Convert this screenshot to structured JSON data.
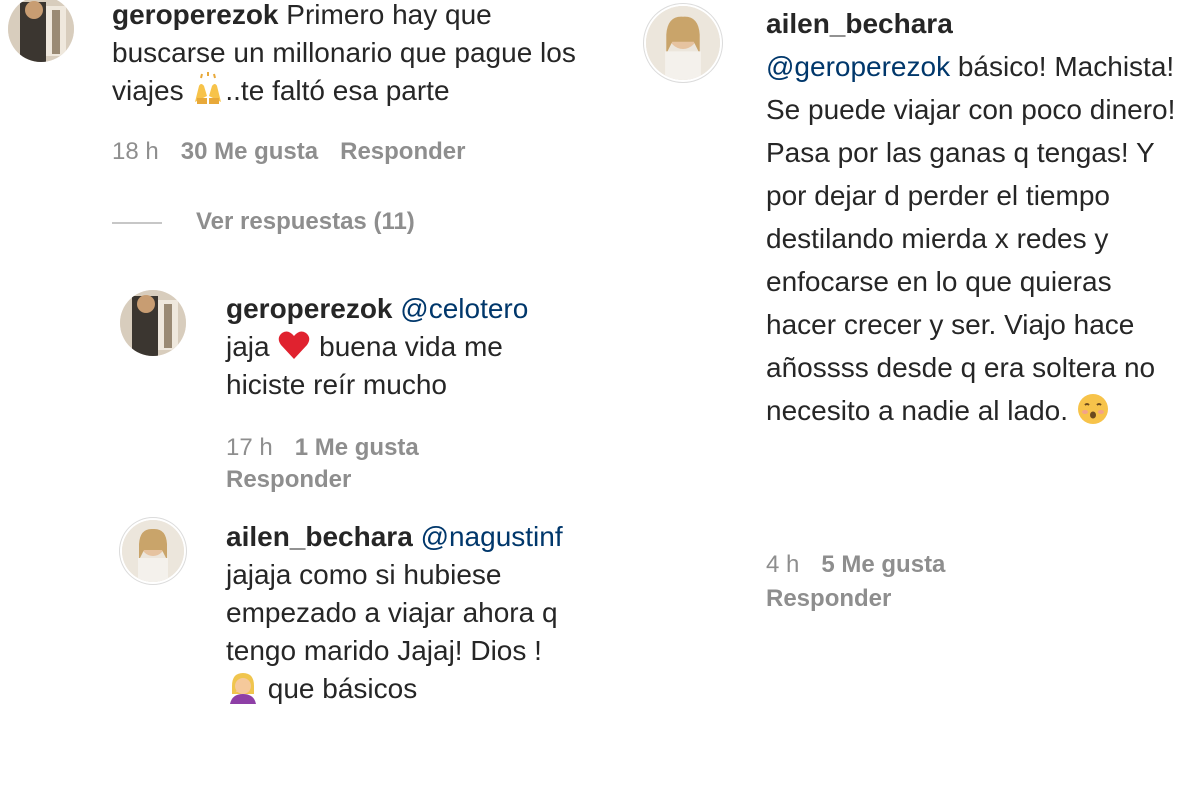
{
  "left": {
    "comment1": {
      "username": "geroperezok",
      "text_part1": "Primero hay que buscarse un millonario que pague los viajes ",
      "emoji": "raising-hands-emoji",
      "text_part2": "..te faltó esa parte",
      "time": "18 h",
      "likes": "30 Me gusta",
      "reply": "Responder"
    },
    "view_replies": "Ver respuestas (11)",
    "reply1": {
      "username": "geroperezok",
      "mention": "@celotero",
      "text_part1": "jaja ",
      "emoji": "red-heart-emoji",
      "text_part2": " buena vida me hiciste reír mucho",
      "time": "17 h",
      "likes": "1 Me gusta",
      "reply": "Responder"
    },
    "reply2": {
      "username": "ailen_bechara",
      "mention": "@nagustinf",
      "text_part1": "jajaja como si hubiese empezado a viajar ahora q tengo marido Jajaj! Dios !",
      "emoji": "woman-facepalming-emoji",
      "text_part2": " que básicos"
    }
  },
  "right": {
    "comment": {
      "username": "ailen_bechara",
      "mention": "@geroperezok",
      "text_part1": " básico! Machista! Se puede viajar con poco dinero! Pasa por las ganas q tengas! Y por dejar d perder el tiempo destilando mierda x redes y enfocarse en lo que quieras hacer crecer y ser. Viajo hace añossss desde q era soltera no necesito a nadie al lado. ",
      "emoji": "kissing-face-emoji",
      "time": "4 h",
      "likes": "5 Me gusta",
      "reply": "Responder"
    }
  },
  "colors": {
    "text": "#262626",
    "muted": "#8e8e8e",
    "mention": "#00376b"
  }
}
